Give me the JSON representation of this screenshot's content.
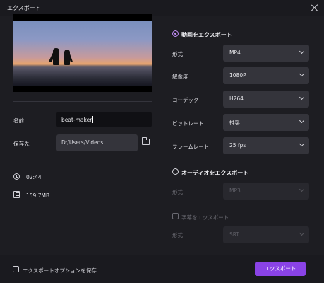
{
  "window": {
    "title": "エクスポート"
  },
  "left": {
    "name_label": "名前",
    "name_value": "beat-maker",
    "save_label": "保存先",
    "save_path": "D:/Users/Videos",
    "duration": "02:44",
    "size": "159.7MB"
  },
  "video": {
    "section_label": "動画をエクスポート",
    "rows": [
      {
        "label": "形式",
        "value": "MP4"
      },
      {
        "label": "解像度",
        "value": "1080P"
      },
      {
        "label": "コーデック",
        "value": "H264"
      },
      {
        "label": "ビットレート",
        "value": "推奨"
      },
      {
        "label": "フレームレート",
        "value": "25  fps"
      }
    ]
  },
  "audio": {
    "section_label": "オーディオをエクスポート",
    "format_label": "形式",
    "format_value": "MP3"
  },
  "subtitle": {
    "checkbox_label": "字幕をエクスポート",
    "format_label": "形式",
    "format_value": "SRT"
  },
  "footer": {
    "save_options_label": "エクスポートオプションを保存",
    "export_button": "エクスポート"
  },
  "colors": {
    "accent": "#8a43e6",
    "radio_on": "#c08cf5",
    "background": "#1d1d22"
  }
}
